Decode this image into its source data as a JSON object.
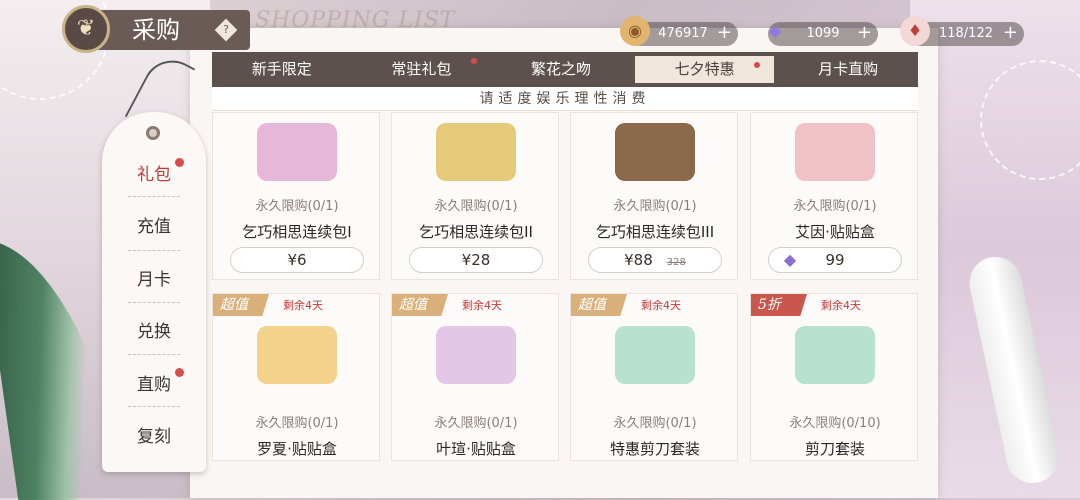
{
  "header": {
    "title": "采购",
    "shop_title": "SHOPPING LIST",
    "help": "?"
  },
  "resources": [
    {
      "value": "476917",
      "icon": "cookie-icon"
    },
    {
      "value": "1099",
      "icon": "diamond-icon"
    },
    {
      "value": "118/122",
      "icon": "cake-icon"
    }
  ],
  "tabs": [
    {
      "label": "新手限定",
      "dot": false,
      "active": false
    },
    {
      "label": "常驻礼包",
      "dot": true,
      "active": false
    },
    {
      "label": "繁花之吻",
      "dot": false,
      "active": false
    },
    {
      "label": "七夕特惠",
      "dot": true,
      "active": true
    },
    {
      "label": "月卡直购",
      "dot": false,
      "active": false
    }
  ],
  "notice": "请适度娱乐理性消费",
  "sidebar": [
    {
      "label": "礼包",
      "active": true,
      "dot": true
    },
    {
      "label": "充值",
      "active": false,
      "dot": false
    },
    {
      "label": "月卡",
      "active": false,
      "dot": false
    },
    {
      "label": "兑换",
      "active": false,
      "dot": false
    },
    {
      "label": "直购",
      "active": false,
      "dot": true
    },
    {
      "label": "复刻",
      "active": false,
      "dot": false
    }
  ],
  "products_row1": [
    {
      "limit": "永久限购(0/1)",
      "name": "乞巧相思连续包I",
      "price": "¥6",
      "orig": "",
      "gem": false,
      "color": "#e6b7d9"
    },
    {
      "limit": "永久限购(0/1)",
      "name": "乞巧相思连续包II",
      "price": "¥28",
      "orig": "",
      "gem": false,
      "color": "#e7c97a"
    },
    {
      "limit": "永久限购(0/1)",
      "name": "乞巧相思连续包III",
      "price": "¥88",
      "orig": "328",
      "gem": false,
      "color": "#8a6a4a"
    },
    {
      "limit": "永久限购(0/1)",
      "name": "艾因·贴贴盒",
      "price": "99",
      "orig": "",
      "gem": true,
      "color": "#f0c2c8"
    }
  ],
  "products_row2": [
    {
      "badge": "超值",
      "badge_color": "#d9b07a",
      "remain": "剩余4天",
      "limit": "永久限购(0/1)",
      "name": "罗夏·贴贴盒",
      "color": "#f3d28c"
    },
    {
      "badge": "超值",
      "badge_color": "#d9b07a",
      "remain": "剩余4天",
      "limit": "永久限购(0/1)",
      "name": "叶瑄·贴贴盒",
      "color": "#e3c7e8"
    },
    {
      "badge": "超值",
      "badge_color": "#d9b07a",
      "remain": "剩余4天",
      "limit": "永久限购(0/1)",
      "name": "特惠剪刀套装",
      "color": "#b8e2cf"
    },
    {
      "badge": "5折",
      "badge_color": "#c9574d",
      "remain": "剩余4天",
      "limit": "永久限购(0/10)",
      "name": "剪刀套装",
      "color": "#b8e2cf"
    }
  ]
}
